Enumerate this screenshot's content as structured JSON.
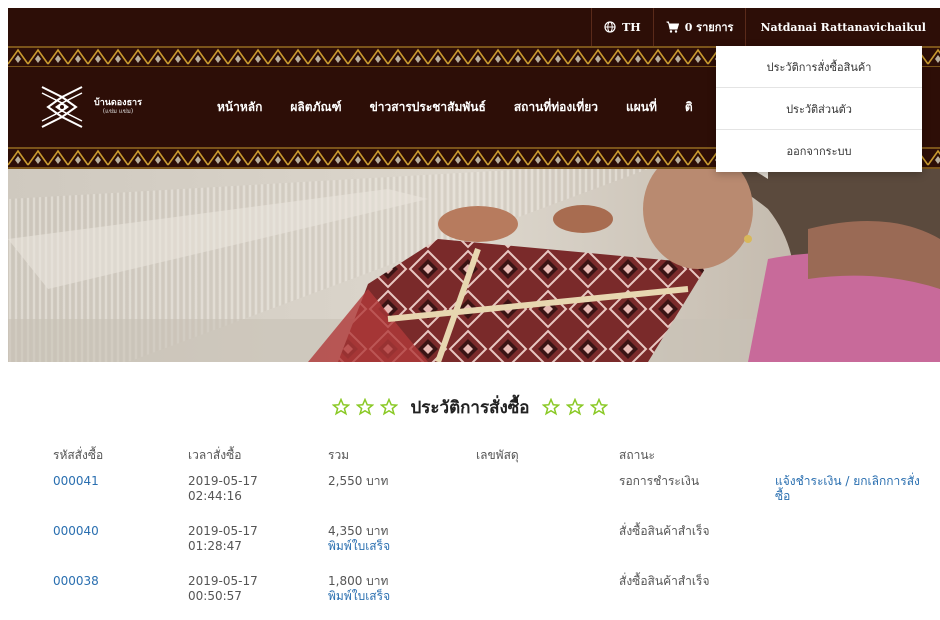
{
  "topbar": {
    "language": "TH",
    "cart": "0 รายการ",
    "user": "Natdanai Rattanavichaikul"
  },
  "logo": {
    "line1": "บ้านดองธาร",
    "line2": "(แข่ม แข่ม)"
  },
  "nav": {
    "items": [
      "หน้าหลัก",
      "ผลิตภัณฑ์",
      "ข่าวสารประชาสัมพันธ์",
      "สถานที่ท่องเที่ยว",
      "แผนที่",
      "ติ"
    ]
  },
  "dropdown": {
    "items": [
      "ประวัติการสั่งซื้อสินค้า",
      "ประวัติส่วนตัว",
      "ออกจากระบบ"
    ]
  },
  "page": {
    "title": "ประวัติการสั่งซื้อ"
  },
  "table": {
    "headers": [
      "รหัสสั่งซื้อ",
      "เวลาสั่งซื้อ",
      "รวม",
      "เลขพัสดุ",
      "สถานะ",
      ""
    ],
    "rows": [
      {
        "id": "000041",
        "date": "2019-05-17",
        "time": "02:44:16",
        "total": "2,550 บาท",
        "print": "",
        "tracking": "",
        "status": "รอการชำระเงิน",
        "action": "แจ้งชำระเงิน / ยกเลิกการสั่งซื้อ"
      },
      {
        "id": "000040",
        "date": "2019-05-17",
        "time": "01:28:47",
        "total": "4,350 บาท",
        "print": "พิมพ์ใบเสร็จ",
        "tracking": "",
        "status": "สั่งซื้อสินค้าสำเร็จ",
        "action": ""
      },
      {
        "id": "000038",
        "date": "2019-05-17",
        "time": "00:50:57",
        "total": "1,800 บาท",
        "print": "พิมพ์ใบเสร็จ",
        "tracking": "",
        "status": "สั่งซื้อสินค้าสำเร็จ",
        "action": ""
      }
    ]
  },
  "colors": {
    "header_bg": "#2d0e07",
    "pattern_gold": "#c99a2e",
    "link": "#2a6fb0",
    "star": "#8ac926"
  },
  "icons": {
    "globe": "globe-icon",
    "cart": "cart-icon",
    "star": "star-outline-icon"
  }
}
